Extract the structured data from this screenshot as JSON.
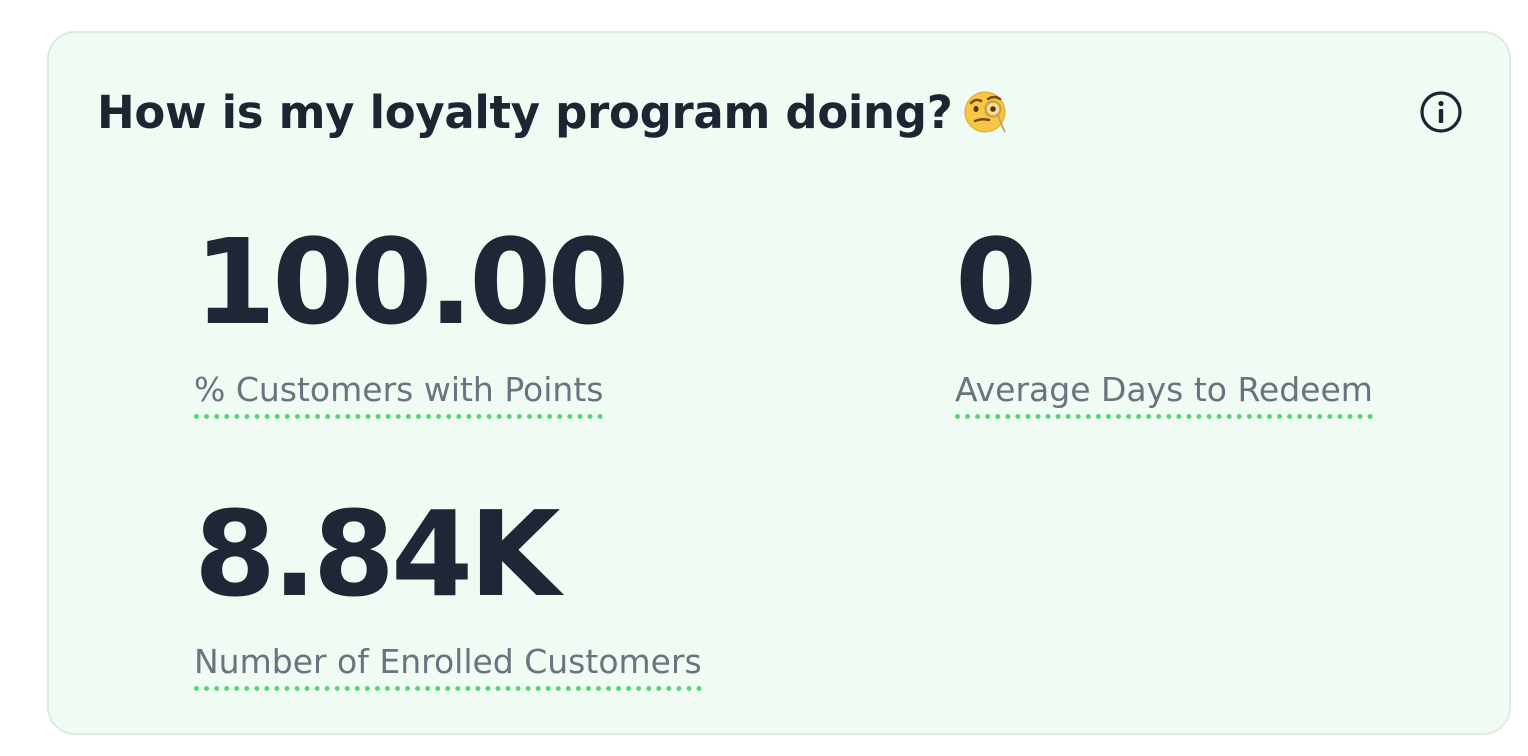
{
  "card": {
    "title": "How is my loyalty program doing?",
    "title_emoji": "face-with-monocle",
    "info_icon": "info-circle-icon",
    "background_color": "#f0fbf3",
    "underline_color": "#5dd27a"
  },
  "stats": [
    {
      "value": "100.00",
      "label": "% Customers with Points"
    },
    {
      "value": "0",
      "label": "Average Days to Redeem"
    },
    {
      "value": "8.84K",
      "label": "Number of Enrolled Customers"
    }
  ]
}
